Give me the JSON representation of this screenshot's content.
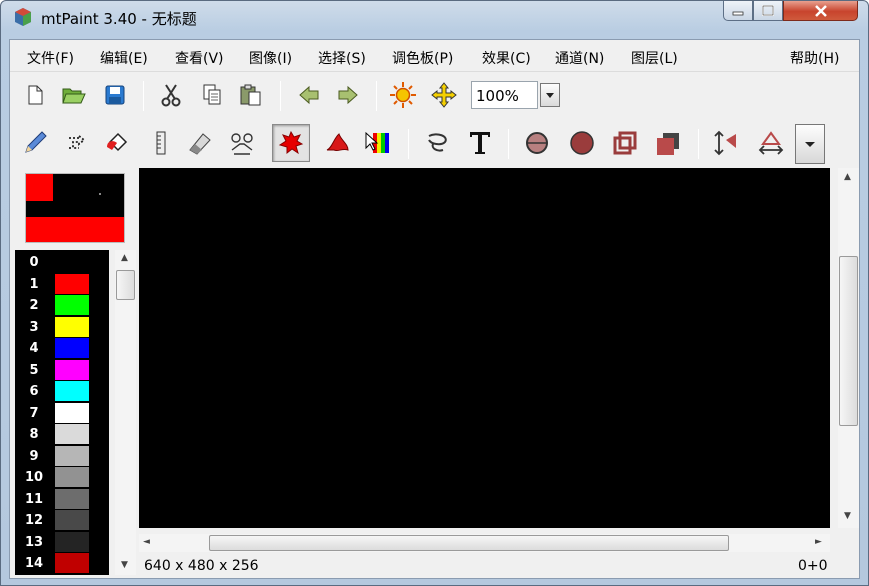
{
  "window": {
    "title": "mtPaint 3.40 - 无标题",
    "icon": "mtpaint-app-icon",
    "controls": [
      "minimize-icon",
      "maximize-icon",
      "close-icon"
    ]
  },
  "menu": {
    "items": [
      "文件(F)",
      "编辑(E)",
      "查看(V)",
      "图像(I)",
      "选择(S)",
      "调色板(P)",
      "效果(C)",
      "通道(N)",
      "图层(L)"
    ],
    "help": "帮助(H)"
  },
  "toolbar_main": {
    "tools": [
      "new-file-icon",
      "open-folder-icon",
      "save-icon",
      "cut-icon",
      "copy-icon",
      "paste-icon",
      "undo-arrow-icon",
      "redo-arrow-icon",
      "brightness-sun-icon",
      "pan-move-icon"
    ],
    "zoom": "100%"
  },
  "toolbar_tools": {
    "tools": [
      "pencil-icon",
      "selection-dots-icon",
      "flood-fill-icon",
      "ruler-line-icon",
      "eraser-icon",
      "clone-brush-icon",
      "paint-brush-icon",
      "smudge-icon",
      "gradient-icon",
      "lasso-icon",
      "text-icon",
      "ellipse-outline-icon",
      "ellipse-filled-icon",
      "rectangle-outline-icon",
      "rectangle-filled-icon",
      "flip-vertical-icon",
      "flip-horizontal-icon"
    ],
    "pressed_tool": "paint-brush-icon"
  },
  "palette": {
    "entries": [
      {
        "index": "0",
        "color": "#000000"
      },
      {
        "index": "1",
        "color": "#ff0000"
      },
      {
        "index": "2",
        "color": "#00ff00"
      },
      {
        "index": "3",
        "color": "#ffff00"
      },
      {
        "index": "4",
        "color": "#0000ff"
      },
      {
        "index": "5",
        "color": "#ff00ff"
      },
      {
        "index": "6",
        "color": "#00ffff"
      },
      {
        "index": "7",
        "color": "#ffffff"
      },
      {
        "index": "8",
        "color": "#dadada"
      },
      {
        "index": "9",
        "color": "#b6b6b6"
      },
      {
        "index": "10",
        "color": "#929292"
      },
      {
        "index": "11",
        "color": "#6d6d6d"
      },
      {
        "index": "12",
        "color": "#494949"
      },
      {
        "index": "13",
        "color": "#242424"
      },
      {
        "index": "14",
        "color": "#c00000"
      }
    ],
    "foreground": "#ff0000",
    "background": "#000000"
  },
  "status": {
    "image_size": "640 x 480 x 256",
    "position": "0+0"
  }
}
